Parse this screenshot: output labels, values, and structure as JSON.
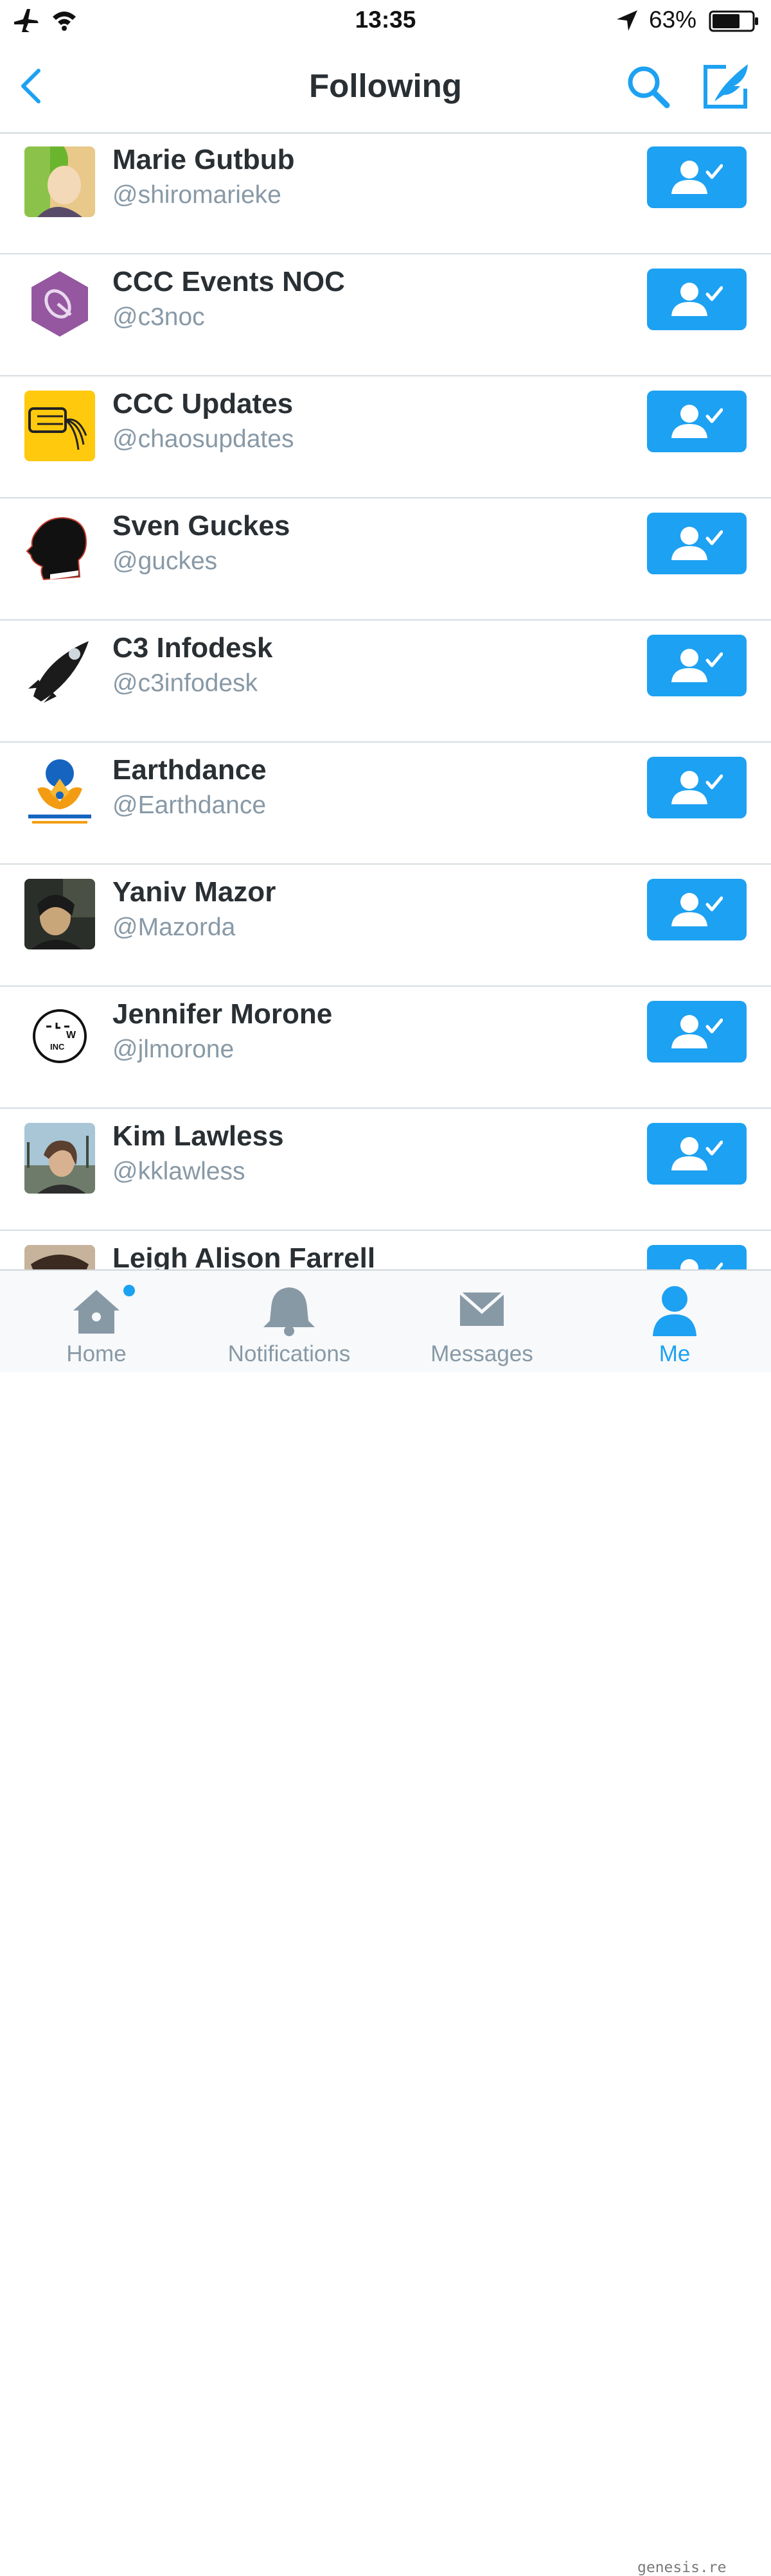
{
  "status_bar": {
    "time": "13:35",
    "battery_percent": "63%"
  },
  "nav": {
    "title": "Following"
  },
  "colors": {
    "accent": "#1da1f2",
    "muted": "#8899a6",
    "text": "#292f33"
  },
  "users": [
    {
      "name": "Marie Gutbub",
      "handle": "@shiromarieke"
    },
    {
      "name": "CCC Events NOC",
      "handle": "@c3noc"
    },
    {
      "name": "CCC Updates",
      "handle": "@chaosupdates"
    },
    {
      "name": "Sven Guckes",
      "handle": "@guckes"
    },
    {
      "name": "C3 Infodesk",
      "handle": "@c3infodesk"
    },
    {
      "name": "Earthdance",
      "handle": "@Earthdance"
    },
    {
      "name": "Yaniv Mazor",
      "handle": "@Mazorda"
    },
    {
      "name": "Jennifer Morone",
      "handle": "@jlmorone"
    },
    {
      "name": "Kim Lawless",
      "handle": "@kklawless"
    },
    {
      "name": "Leigh Alison Farrell",
      "handle": ""
    }
  ],
  "tabs": [
    {
      "label": "Home",
      "icon": "home-icon",
      "notification_dot": true
    },
    {
      "label": "Notifications",
      "icon": "bell-icon"
    },
    {
      "label": "Messages",
      "icon": "envelope-icon"
    },
    {
      "label": "Me",
      "icon": "person-icon",
      "active": true
    }
  ],
  "watermark": "genesis.re"
}
